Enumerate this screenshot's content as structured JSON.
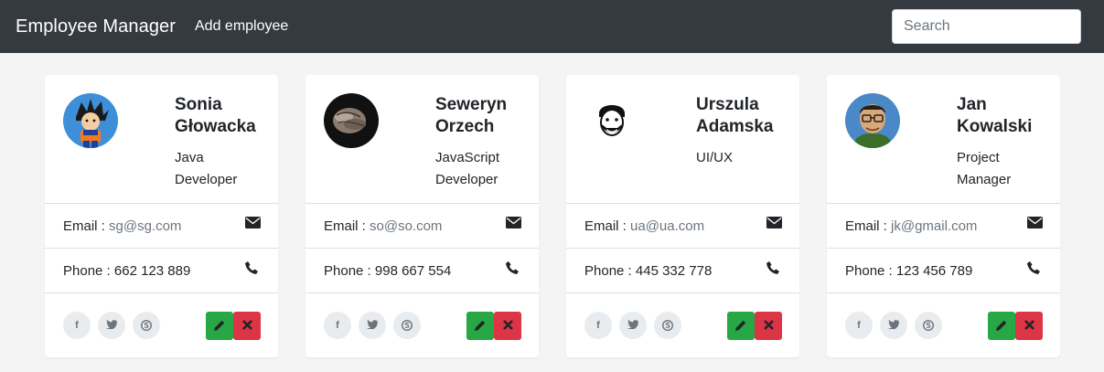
{
  "navbar": {
    "brand": "Employee Manager",
    "add_link": "Add employee",
    "search_placeholder": "Search"
  },
  "colors": {
    "navbar_bg": "#343a40",
    "edit_button": "#28a745",
    "delete_button": "#dc3545",
    "social_bg": "#e9ecef"
  },
  "employees": [
    {
      "name_line1": "Sonia",
      "name_line2": "Głowacka",
      "role_line1": "Java",
      "role_line2": "Developer",
      "email_label": "Email : ",
      "email": "sg@sg.com",
      "phone_label": "Phone : ",
      "phone": "662 123 889",
      "avatar": "cartoon-boy-avatar"
    },
    {
      "name_line1": "Seweryn",
      "name_line2": "Orzech",
      "role_line1": "JavaScript",
      "role_line2": "Developer",
      "email_label": "Email : ",
      "email": "so@so.com",
      "phone_label": "Phone : ",
      "phone": "998 667 554",
      "avatar": "hands-photo-avatar"
    },
    {
      "name_line1": "Urszula",
      "name_line2": "Adamska",
      "role_line1": "UI/UX",
      "role_line2": "",
      "email_label": "Email : ",
      "email": "ua@ua.com",
      "phone_label": "Phone : ",
      "phone": "445 332 778",
      "avatar": "bearded-face-avatar"
    },
    {
      "name_line1": "Jan",
      "name_line2": "Kowalski",
      "role_line1": "Project",
      "role_line2": "Manager",
      "email_label": "Email : ",
      "email": "jk@gmail.com",
      "phone_label": "Phone : ",
      "phone": "123 456 789",
      "avatar": "glasses-man-avatar"
    }
  ],
  "icons": {
    "email": "envelope-icon",
    "phone": "phone-icon",
    "socials": [
      "facebook-icon",
      "twitter-icon",
      "skype-icon"
    ],
    "edit": "pencil-icon",
    "delete": "times-icon"
  }
}
